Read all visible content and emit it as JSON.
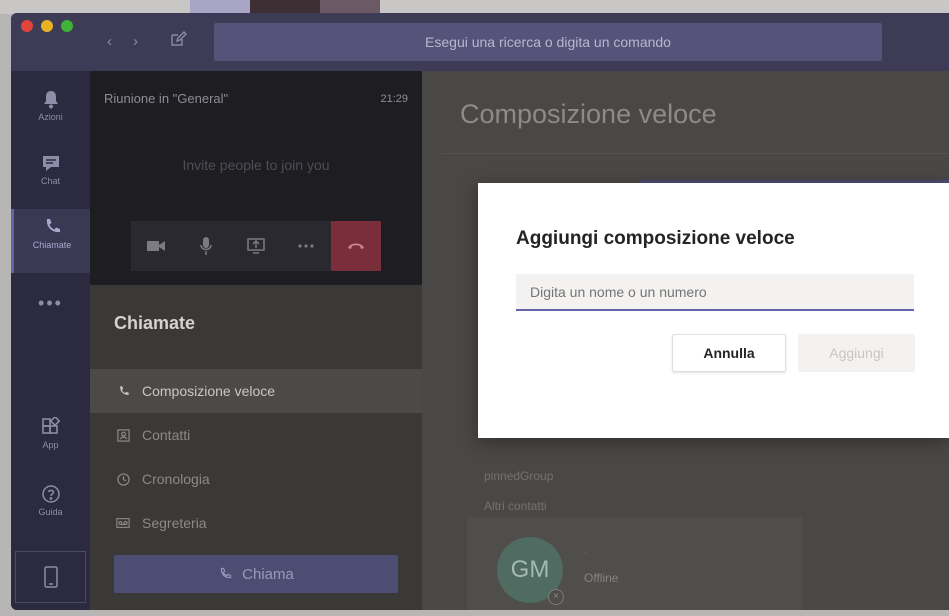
{
  "titlebar": {
    "search_placeholder": "Esegui una ricerca o digita un comando"
  },
  "rail": {
    "items": [
      {
        "label": "Azioni",
        "icon": "bell-icon"
      },
      {
        "label": "Chat",
        "icon": "chat-icon"
      },
      {
        "label": "Chiamate",
        "icon": "phone-icon"
      },
      {
        "label": "App",
        "icon": "apps-icon"
      },
      {
        "label": "Guida",
        "icon": "help-icon"
      }
    ],
    "more": "•••"
  },
  "meeting": {
    "title": "Riunione in \"General\"",
    "time": "21:29",
    "invite_text": "Invite people to join you"
  },
  "calls": {
    "title": "Chiamate",
    "items": [
      {
        "label": "Composizione veloce",
        "icon": "phone-icon"
      },
      {
        "label": "Contatti",
        "icon": "contacts-icon"
      },
      {
        "label": "Cronologia",
        "icon": "clock-icon"
      },
      {
        "label": "Segreteria",
        "icon": "voicemail-icon"
      }
    ],
    "call_button": "Chiama"
  },
  "main": {
    "title": "Composizione veloce",
    "group_label": "pinnedGroup",
    "other_contacts_label": "Altri contatti",
    "contact": {
      "initials": "GM",
      "status": "Offline"
    }
  },
  "dialog": {
    "title": "Aggiungi composizione veloce",
    "input_placeholder": "Digita un nome o un numero",
    "cancel_label": "Annulla",
    "add_label": "Aggiungi"
  },
  "colors": {
    "accent": "#6264a7",
    "hangup": "#7a2e3b"
  }
}
